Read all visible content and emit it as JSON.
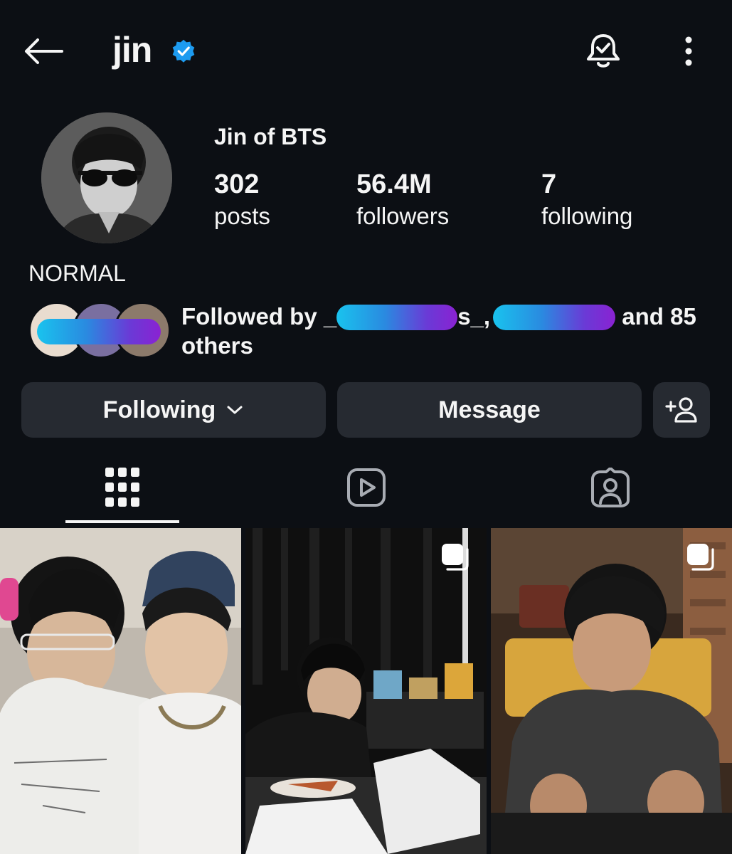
{
  "header": {
    "username": "jin",
    "icons": {
      "back": "arrow-left-icon",
      "verified": "verified-badge-icon",
      "notifications": "bell-check-icon",
      "more": "more-vertical-icon"
    }
  },
  "profile": {
    "display_name": "Jin of BTS",
    "stats": {
      "posts": {
        "value": "302",
        "label": "posts"
      },
      "followers": {
        "value": "56.4M",
        "label": "followers"
      },
      "following": {
        "value": "7",
        "label": "following"
      }
    },
    "bio": "NORMAL",
    "followed_by": {
      "prefix": "Followed by _",
      "mid_sep": "s_,",
      "suffix": "and 85",
      "line2": "others"
    }
  },
  "actions": {
    "following_label": "Following",
    "message_label": "Message"
  },
  "tabs": [
    "posts-grid",
    "reels",
    "tagged"
  ],
  "colors": {
    "background": "#0c0f14",
    "button": "#262a31",
    "verified": "#1d9bf0",
    "text": "#f5f5f5"
  }
}
